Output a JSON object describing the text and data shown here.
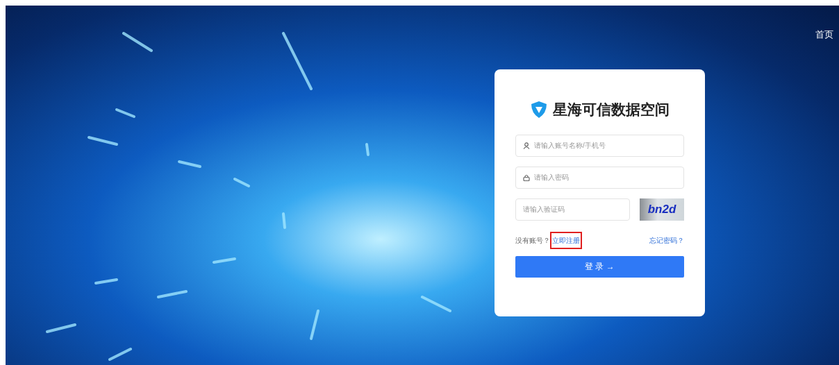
{
  "nav": {
    "home_link": "首页"
  },
  "login": {
    "title": "星海可信数据空间",
    "fields": [
      {
        "kind": "user",
        "placeholder": "请输入账号名称/手机号"
      },
      {
        "kind": "password",
        "placeholder": "请输入密码"
      },
      {
        "kind": "captcha",
        "placeholder": "请输入验证码",
        "captcha_text": "bn2d"
      }
    ],
    "register_prompt": "没有账号？",
    "register_link": "立即注册",
    "register_highlighted": true,
    "forgot_link": "忘记密码？",
    "submit_button": "登 录 →"
  }
}
